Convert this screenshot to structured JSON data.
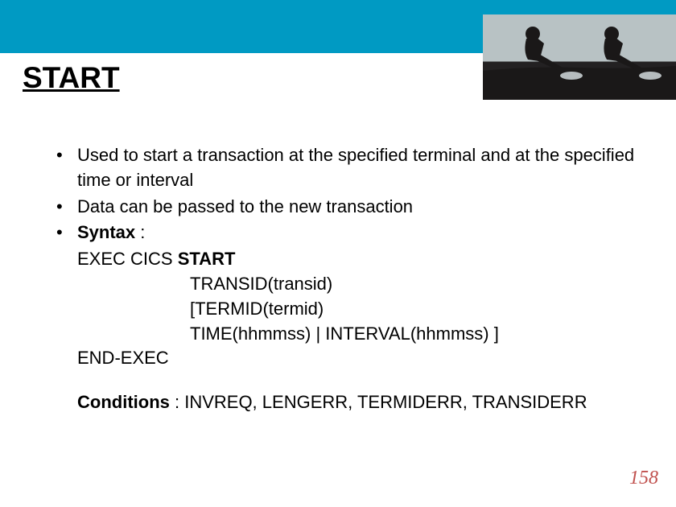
{
  "header": {
    "title": "START",
    "band_color": "#009ac3",
    "decorative_image": "two-rowers-silhouette"
  },
  "bullets": [
    {
      "text": "Used to start a transaction at the specified terminal and at the specified time or interval"
    },
    {
      "text": "Data can be passed to the new transaction"
    },
    {
      "label": "Syntax",
      "after_label": " :",
      "syntax_lines": [
        {
          "indent": "indent1",
          "prefix": "EXEC CICS ",
          "bold": "START",
          "suffix": ""
        },
        {
          "indent": "indent2",
          "prefix": "TRANSID(transid)",
          "bold": "",
          "suffix": ""
        },
        {
          "indent": "indent2",
          "prefix": "[TERMID(termid)",
          "bold": "",
          "suffix": ""
        },
        {
          "indent": "indent2",
          "prefix": "TIME(hhmmss) | INTERVAL(hhmmss) ]",
          "bold": "",
          "suffix": ""
        },
        {
          "indent": "indent1",
          "prefix": "END-EXEC",
          "bold": "",
          "suffix": ""
        }
      ]
    }
  ],
  "conditions": {
    "label": "Conditions",
    "text": " : INVREQ, LENGERR, TERMIDERR, TRANSIDERR"
  },
  "page_number": "158"
}
